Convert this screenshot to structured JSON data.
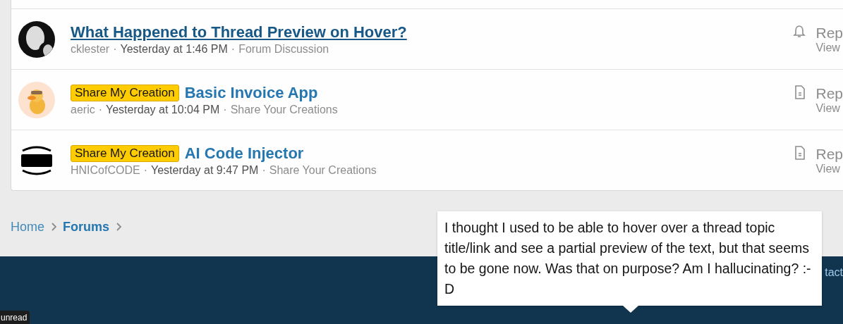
{
  "threads": [
    {
      "title": "What Happened to Thread Preview on Hover?",
      "hovered": true,
      "author": "cklester",
      "separator_1": "·",
      "date": "Yesterday at 1:46 PM",
      "separator_2": "·",
      "forum": "Forum Discussion",
      "status": {
        "kind": "bell"
      },
      "stat_1": "Rep",
      "stat_2": "View"
    },
    {
      "title": "Basic Invoice App",
      "hovered": false,
      "prefix": "Share My Creation",
      "author": "aeric",
      "separator_1": "·",
      "date": "Yesterday at 10:04 PM",
      "separator_2": "·",
      "forum": "Share Your Creations",
      "status": {
        "kind": "document"
      },
      "stat_1": "Rep",
      "stat_2": "View"
    },
    {
      "title": "AI Code Injector",
      "hovered": false,
      "prefix": "Share My Creation",
      "author": "HNICofCODE",
      "separator_1": "·",
      "date": "Yesterday at 9:47 PM",
      "separator_2": "·",
      "forum": "Share Your Creations",
      "status": {
        "kind": "document"
      },
      "stat_1": "Rep",
      "stat_2": "View"
    }
  ],
  "breadcrumb": [
    {
      "label": "Home",
      "selected": false
    },
    {
      "label": "Forums",
      "selected": true
    }
  ],
  "footer": {
    "link": "tact"
  },
  "preview_tooltip": "I thought I used to be able to hover over a thread topic title/link and see a partial preview of the text, but that seems to be gone now. Was that on purpose? Am I hallucinating? :-D",
  "status_tooltip": "unread"
}
